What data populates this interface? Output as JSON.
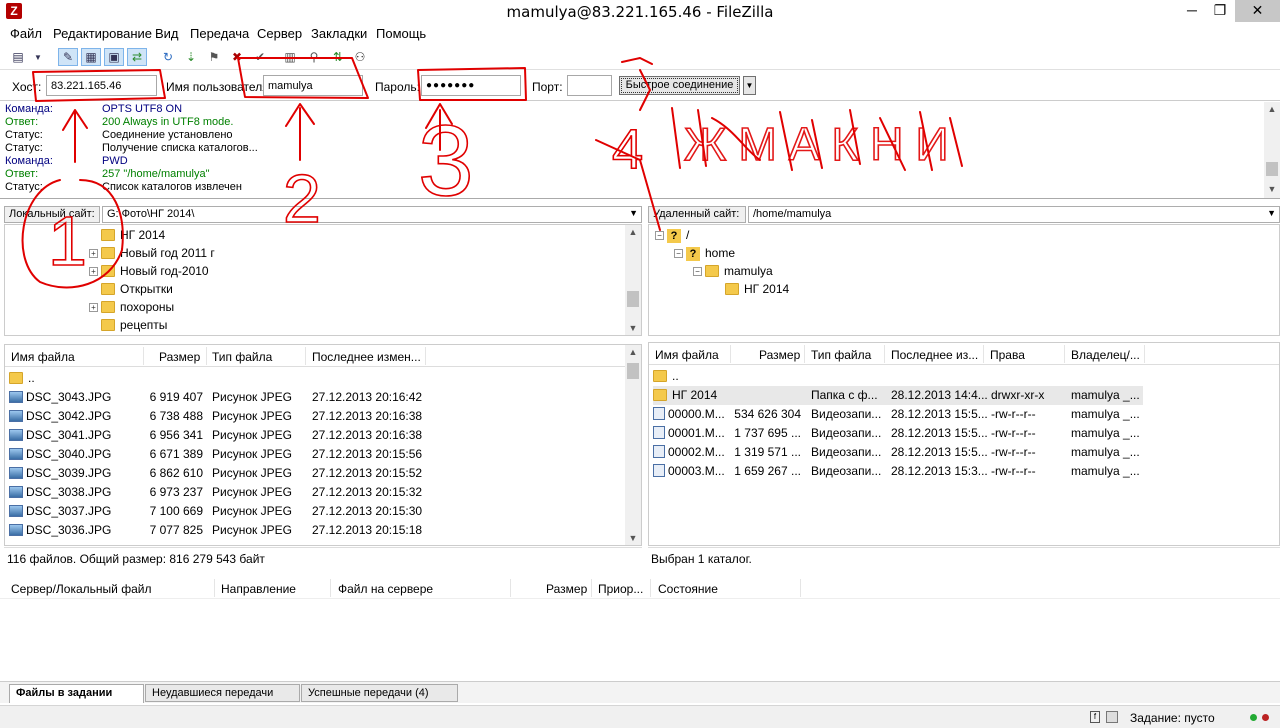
{
  "window": {
    "title": "mamulya@83.221.165.46 - FileZilla",
    "minimize": "─",
    "maximize": "❐",
    "close": "✕"
  },
  "menu": [
    "Файл",
    "Редактирование",
    "Вид",
    "Передача",
    "Сервер",
    "Закладки",
    "Помощь"
  ],
  "quickconnect": {
    "host_label": "Хост:",
    "host_value": "83.221.165.46",
    "user_label": "Имя пользователя",
    "user_value": "mamulya",
    "pass_label": "Пароль:",
    "pass_value": "●●●●●●●",
    "port_label": "Порт:",
    "port_value": "",
    "connect_button": "Быстрое соединение",
    "dropdown": "▼"
  },
  "log": [
    {
      "key": "Команда:",
      "value": "OPTS UTF8 ON",
      "color": "#000080"
    },
    {
      "key": "Ответ:",
      "value": "200 Always in UTF8 mode.",
      "color": "#008000"
    },
    {
      "key": "Статус:",
      "value": "Соединение установлено",
      "color": "#000000"
    },
    {
      "key": "Статус:",
      "value": "Получение списка каталогов...",
      "color": "#000000"
    },
    {
      "key": "Команда:",
      "value": "PWD",
      "color": "#000080"
    },
    {
      "key": "Ответ:",
      "value": "257 \"/home/mamulya\"",
      "color": "#008000"
    },
    {
      "key": "Статус:",
      "value": "Список каталогов извлечен",
      "color": "#000000"
    }
  ],
  "local": {
    "site_label": "Локальный сайт:",
    "path": "G:\\Фото\\НГ 2014\\",
    "tree": [
      {
        "name": "НГ 2014",
        "expander": ""
      },
      {
        "name": "Новый год 2011 г",
        "expander": "+"
      },
      {
        "name": "Новый год-2010",
        "expander": "+"
      },
      {
        "name": "Открытки",
        "expander": ""
      },
      {
        "name": "похороны",
        "expander": "+"
      },
      {
        "name": "рецепты",
        "expander": ""
      }
    ],
    "columns": [
      "Имя файла",
      "Размер",
      "Тип файла",
      "Последнее измен..."
    ],
    "parent": "..",
    "files": [
      {
        "name": "DSC_3043.JPG",
        "size": "6 919 407",
        "type": "Рисунок JPEG",
        "modified": "27.12.2013 20:16:42"
      },
      {
        "name": "DSC_3042.JPG",
        "size": "6 738 488",
        "type": "Рисунок JPEG",
        "modified": "27.12.2013 20:16:38"
      },
      {
        "name": "DSC_3041.JPG",
        "size": "6 956 341",
        "type": "Рисунок JPEG",
        "modified": "27.12.2013 20:16:38"
      },
      {
        "name": "DSC_3040.JPG",
        "size": "6 671 389",
        "type": "Рисунок JPEG",
        "modified": "27.12.2013 20:15:56"
      },
      {
        "name": "DSC_3039.JPG",
        "size": "6 862 610",
        "type": "Рисунок JPEG",
        "modified": "27.12.2013 20:15:52"
      },
      {
        "name": "DSC_3038.JPG",
        "size": "6 973 237",
        "type": "Рисунок JPEG",
        "modified": "27.12.2013 20:15:32"
      },
      {
        "name": "DSC_3037.JPG",
        "size": "7 100 669",
        "type": "Рисунок JPEG",
        "modified": "27.12.2013 20:15:30"
      },
      {
        "name": "DSC_3036.JPG",
        "size": "7 077 825",
        "type": "Рисунок JPEG",
        "modified": "27.12.2013 20:15:18"
      }
    ],
    "status": "116 файлов. Общий размер: 816 279 543 байт"
  },
  "remote": {
    "site_label": "Удаленный сайт:",
    "path": "/home/mamulya",
    "tree": [
      {
        "name": "/",
        "icon": "?",
        "expander": "−"
      },
      {
        "name": "home",
        "icon": "?",
        "expander": "−"
      },
      {
        "name": "mamulya",
        "icon": "",
        "expander": "−"
      },
      {
        "name": "НГ 2014",
        "icon": "",
        "expander": ""
      }
    ],
    "columns": [
      "Имя файла",
      "Размер",
      "Тип файла",
      "Последнее из...",
      "Права",
      "Владелец/..."
    ],
    "parent": "..",
    "files": [
      {
        "name": "НГ 2014",
        "size": "",
        "type": "Папка с ф...",
        "modified": "28.12.2013 14:4...",
        "perms": "drwxr-xr-x",
        "owner": "mamulya _...",
        "kind": "folder"
      },
      {
        "name": "00000.M...",
        "size": "534 626 304",
        "type": "Видеозапи...",
        "modified": "28.12.2013 15:5...",
        "perms": "-rw-r--r--",
        "owner": "mamulya _...",
        "kind": "video"
      },
      {
        "name": "00001.M...",
        "size": "1 737 695 ...",
        "type": "Видеозапи...",
        "modified": "28.12.2013 15:5...",
        "perms": "-rw-r--r--",
        "owner": "mamulya _...",
        "kind": "video"
      },
      {
        "name": "00002.M...",
        "size": "1 319 571 ...",
        "type": "Видеозапи...",
        "modified": "28.12.2013 15:5...",
        "perms": "-rw-r--r--",
        "owner": "mamulya _...",
        "kind": "video"
      },
      {
        "name": "00003.M...",
        "size": "1 659 267 ...",
        "type": "Видеозапи...",
        "modified": "28.12.2013 15:3...",
        "perms": "-rw-r--r--",
        "owner": "mamulya _...",
        "kind": "video"
      }
    ],
    "status": "Выбран 1 каталог."
  },
  "queue": {
    "columns": [
      "Сервер/Локальный файл",
      "Направление",
      "Файл на сервере",
      "Размер",
      "Приор...",
      "Состояние"
    ],
    "tabs": [
      "Файлы в задании",
      "Неудавшиеся передачи",
      "Успешные передачи (4)"
    ]
  },
  "statusbar": {
    "queue": "Задание: пусто"
  },
  "annotations": {
    "n1": "1",
    "n2": "2",
    "n3": "3",
    "n4": "4",
    "word": "ЖМАКНИ",
    "color": "#e00000"
  }
}
